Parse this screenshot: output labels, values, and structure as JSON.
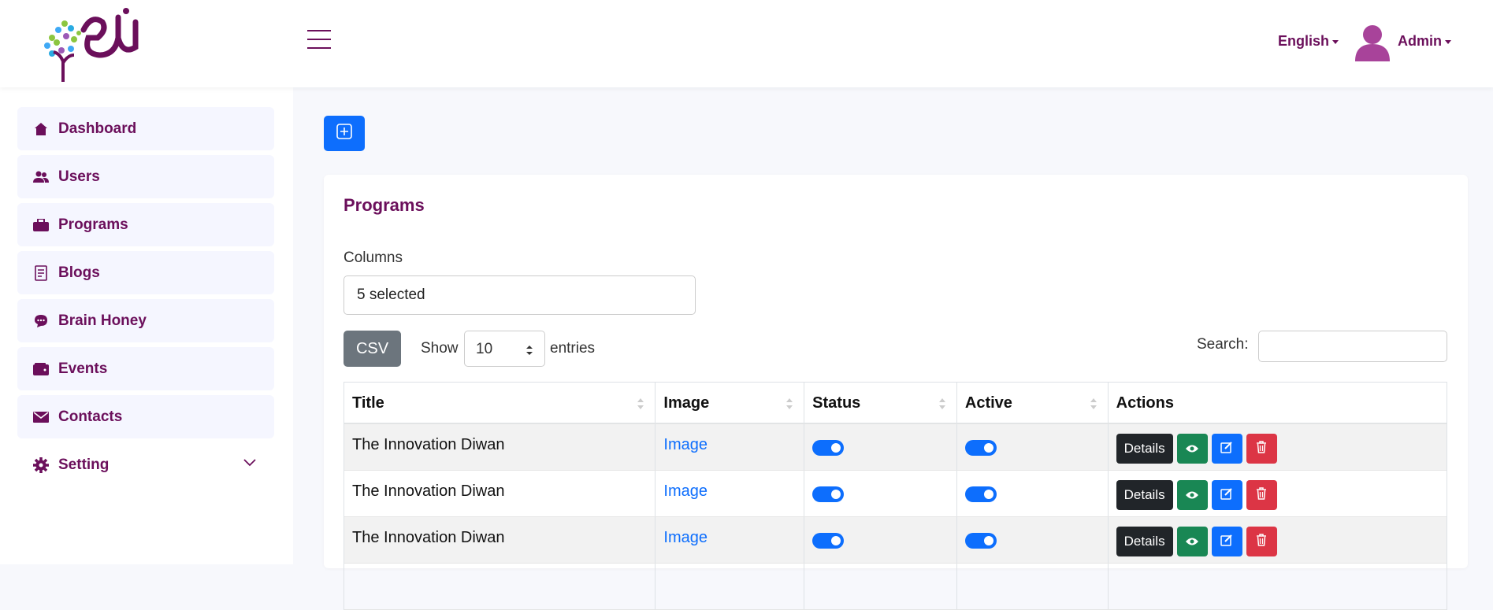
{
  "header": {
    "language": "English",
    "user": "Admin"
  },
  "sidebar": {
    "items": [
      {
        "label": "Dashboard",
        "icon": "home-icon"
      },
      {
        "label": "Users",
        "icon": "users-icon"
      },
      {
        "label": "Programs",
        "icon": "briefcase-icon"
      },
      {
        "label": "Blogs",
        "icon": "document-icon"
      },
      {
        "label": "Brain Honey",
        "icon": "chat-icon"
      },
      {
        "label": "Events",
        "icon": "wallet-icon"
      },
      {
        "label": "Contacts",
        "icon": "envelope-icon"
      },
      {
        "label": "Setting",
        "icon": "gear-icon"
      }
    ]
  },
  "main": {
    "card_title": "Programs",
    "columns_label": "Columns",
    "columns_value": "5 selected",
    "csv_label": "CSV",
    "show_label": "Show",
    "entries_value": "10",
    "entries_label": "entries",
    "search_label": "Search:"
  },
  "table": {
    "headers": [
      "Title",
      "Image",
      "Status",
      "Active",
      "Actions"
    ],
    "rows": [
      {
        "title": "The Innovation Diwan",
        "image": "Image",
        "status": true,
        "active": true
      },
      {
        "title": "The Innovation Diwan",
        "image": "Image",
        "status": true,
        "active": true
      },
      {
        "title": "The Innovation Diwan",
        "image": "Image",
        "status": true,
        "active": true
      }
    ],
    "details_label": "Details"
  },
  "colors": {
    "brand": "#6b0f5b",
    "primary": "#0d6efd",
    "success": "#198754",
    "danger": "#dc3545",
    "secondary": "#6c757d"
  }
}
